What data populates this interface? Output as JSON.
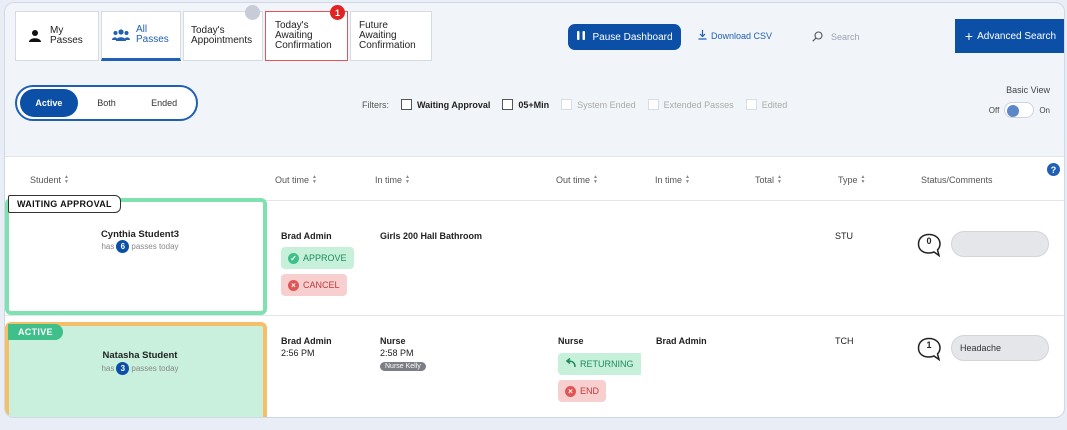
{
  "tabs": [
    {
      "label": "My\nPasses"
    },
    {
      "label": "All\nPasses"
    },
    {
      "label": "Today's\nAppointments",
      "badge": ""
    },
    {
      "label": "Today's\nAwaiting\nConfirmation",
      "badge": "1"
    },
    {
      "label": "Future\nAwaiting\nConfirmation"
    }
  ],
  "toolbar": {
    "pause_label": "Pause Dashboard",
    "download_label": "Download CSV",
    "search_placeholder": "Search",
    "advanced_label": "Advanced Search"
  },
  "view_toggle": {
    "options": [
      "Active",
      "Both",
      "Ended"
    ],
    "selected": "Active"
  },
  "filters": {
    "label": "Filters:",
    "items": [
      "Waiting Approval",
      "05+Min",
      "System Ended",
      "Extended Passes",
      "Edited"
    ]
  },
  "basic_view": {
    "label": "Basic View",
    "off": "Off",
    "on": "On"
  },
  "columns": [
    "Student",
    "Out time",
    "In time",
    "Out time",
    "In time",
    "Total",
    "Type",
    "Status/Comments"
  ],
  "rows": [
    {
      "status": "WAITING APPROVAL",
      "student": "Cynthia Student3",
      "passes_prefix": "has",
      "passes_count": "6",
      "passes_suffix": "passes today",
      "out_by": "Brad Admin",
      "destination": "Girls 200 Hall Bathroom",
      "approve_label": "APPROVE",
      "cancel_label": "CANCEL",
      "type": "STU",
      "comment_count": "0",
      "comment": ""
    },
    {
      "status": "ACTIVE",
      "student": "Natasha Student",
      "passes_prefix": "has",
      "passes_count": "3",
      "passes_suffix": "passes today",
      "out_by": "Brad Admin",
      "out_time": "2:56 PM",
      "in_location": "Nurse",
      "in_time": "2:58 PM",
      "in_teacher": "Nurse Kelly",
      "out2_location": "Nurse",
      "returning_label": "RETURNING",
      "end_label": "END",
      "in2_by": "Brad Admin",
      "type": "TCH",
      "comment_count": "1",
      "comment": "Headache"
    }
  ],
  "colors": {
    "primary": "#0b4fa6",
    "approve": "#c6f0da",
    "cancel": "#f8cfcf",
    "waiting_border": "#7fe1b0",
    "active_border": "#f6be66",
    "active_fill": "#c8f0dc"
  }
}
